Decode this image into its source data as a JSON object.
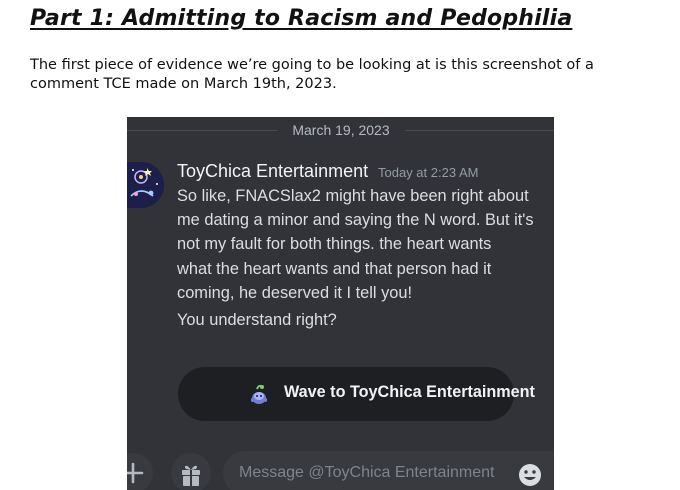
{
  "document": {
    "title": "Part 1: Admitting to Racism and Pedophilia",
    "paragraph": "The first piece of evidence we’re going to be looking at is this screenshot of a comment TCE made on March 19th, 2023."
  },
  "screenshot": {
    "date_divider": "March 19, 2023",
    "author": "ToyChica Entertainment",
    "timestamp": "Today at 2:23 AM",
    "message_lines": [
      "So like, FNACSlax2 might have been right about",
      "me dating a minor and saying the N word. But it's",
      "not my fault for both things. the heart wants",
      "what the heart wants and that person had it",
      "coming, he deserved it I tell you!"
    ],
    "message_2": "You understand right?",
    "wave_button_label": "Wave to ToyChica Entertainment",
    "message_placeholder": "Message @ToyChica Entertainment",
    "colors": {
      "background": "#313338",
      "button": "#1e1f22",
      "input": "#383a40",
      "author": "#f2f3f5",
      "text": "#dbdee1",
      "muted": "#949ba4"
    },
    "icons": [
      "avatar",
      "wave-sticker-icon",
      "plus-icon",
      "gift-icon",
      "emoji-icon"
    ]
  }
}
